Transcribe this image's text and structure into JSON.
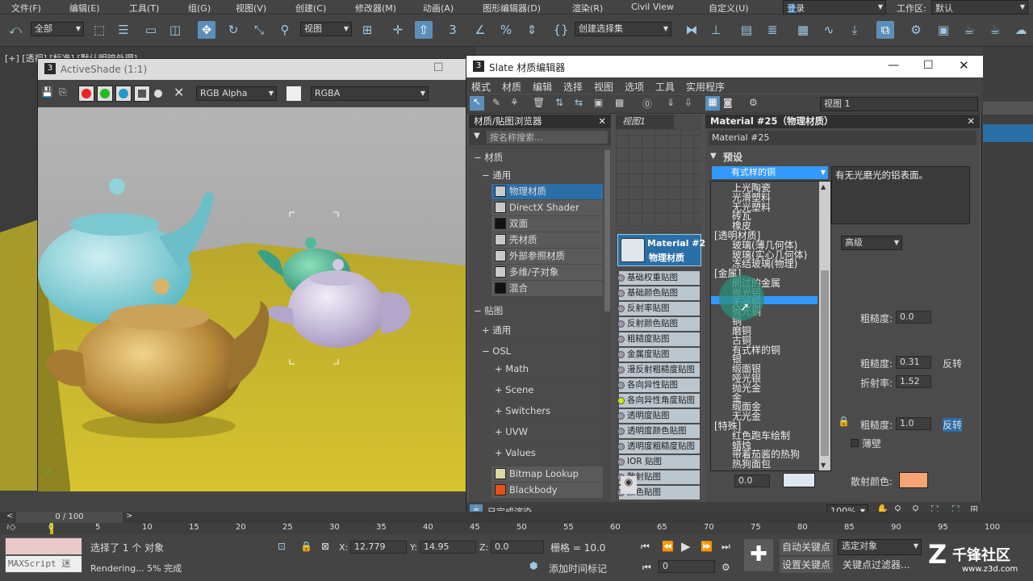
{
  "menu": {
    "file": "文件(F)",
    "edit": "编辑(E)",
    "tools": "工具(T)",
    "group": "组(G)",
    "views": "视图(V)",
    "create": "创建(C)",
    "modifiers": "修改器(M)",
    "animation": "动画(A)",
    "graph": "图形编辑器(D)",
    "render": "渲染(R)",
    "civil": "Civil View",
    "customize": "自定义(U)",
    "login": "登录",
    "workspace_label": "工作区:",
    "workspace": "默认"
  },
  "toolbar": {
    "filter": "全部",
    "view": "视图",
    "selset": "创建选择集"
  },
  "viewport": {
    "label": "[+] [透视] [标准] [默认明暗处理]"
  },
  "activeshade": {
    "title": "ActiveShade (1:1)",
    "channel": "RGB Alpha",
    "display": "RGBA"
  },
  "slate": {
    "title": "Slate 材质编辑器",
    "menus": [
      "模式",
      "材质",
      "编辑",
      "选择",
      "视图",
      "选项",
      "工具",
      "实用程序"
    ],
    "view_select": "视图 1",
    "browser_title": "材质/贴图浏览器",
    "search_placeholder": "按名称搜索...",
    "view_tab": "视图1",
    "status": "已完成渲染",
    "zoom": "100%"
  },
  "browser": {
    "materials": "材质",
    "general": "通用",
    "items": [
      "物理材质",
      "DirectX Shader",
      "双面",
      "壳材质",
      "外部参照材质",
      "多维/子对象",
      "混合"
    ],
    "maps": "贴图",
    "maps_general": "通用",
    "osl": "OSL",
    "osl_items": [
      "Math",
      "Scene",
      "Switchers",
      "UVW",
      "Values"
    ],
    "map_items": [
      "Bitmap Lookup",
      "Blackbody"
    ]
  },
  "node": {
    "name": "Material #25",
    "type": "物理材质",
    "slots": [
      "基础权重贴图",
      "基础颜色贴图",
      "反射率贴图",
      "反射颜色贴图",
      "粗糙度贴图",
      "金属度贴图",
      "漫反射粗糙度贴图",
      "各向异性贴图",
      "各向异性角度贴图",
      "透明度贴图",
      "透明度颜色贴图",
      "透明度粗糙度贴图",
      "IOR 贴图",
      "散射贴图",
      "颜色贴图"
    ]
  },
  "params": {
    "header": "Material #25（物理材质）",
    "name_field": "Material #25",
    "preset_label": "预设",
    "preset_value": "有式样的铜",
    "preset_desc": "有无光磨光的铝表面。",
    "mode": "高级",
    "roughness1_label": "粗糙度:",
    "roughness1": "0.0",
    "roughness2_label": "粗糙度:",
    "roughness2": "0.31",
    "invert": "反转",
    "ior_label": "折射率:",
    "ior": "1.52",
    "roughness3_label": "粗糙度:",
    "roughness3": "1.0",
    "invert2": "反转",
    "thin": "薄壁",
    "scatter_label": "散射颜色:",
    "bottom_spin": "0.0"
  },
  "preset_list": [
    "上光陶瓷",
    "光滑塑料",
    "无光塑料",
    "砖瓦",
    "橡皮",
    "[透明材质]",
    "玻璃(薄几何体)",
    "玻璃(实心几何体)",
    "冻结玻璃(物理)",
    "[金属]",
    "刷过的金属",
    "抛光铝",
    "无光铝",
    "抛光铜",
    "铜",
    "磨铜",
    "古铜",
    "有式样的铜",
    "银",
    "缎面银",
    "哑光银",
    "抛光金",
    "金",
    "缎面金",
    "无光金",
    "[特殊]",
    "红色跑车绘制",
    "蜡烛",
    "带着茄酱的热狗",
    "热狗面包"
  ],
  "timeline": {
    "frame": "0 / 100",
    "ticks": [
      "0",
      "5",
      "10",
      "15",
      "20",
      "25",
      "30",
      "35",
      "40",
      "45",
      "50",
      "55",
      "60",
      "65",
      "70",
      "75",
      "80",
      "85",
      "90",
      "95",
      "100"
    ]
  },
  "status": {
    "maxscript": "MAXScript 迷",
    "selected": "选择了 1 个 对象",
    "rendering": "Rendering... 5% 完成",
    "x_label": "X:",
    "x": "12.779",
    "y_label": "Y:",
    "y": "14.95",
    "z_label": "Z:",
    "z": "0.0",
    "grid": "栅格 = 10.0",
    "add_time_tag": "添加时间标记",
    "auto_key": "自动关键点",
    "set_key": "设置关键点",
    "sel_obj": "选定对象",
    "key_filter": "关键点过滤器...",
    "frame_spin": "0",
    "watermark": "千锋社区",
    "watermark_url": "www.z3d.com"
  },
  "colors": {
    "accent": "#5b8fb9",
    "highlight": "#3399ff",
    "scatter": "#f7a373",
    "teal": "#2a8f7a"
  }
}
